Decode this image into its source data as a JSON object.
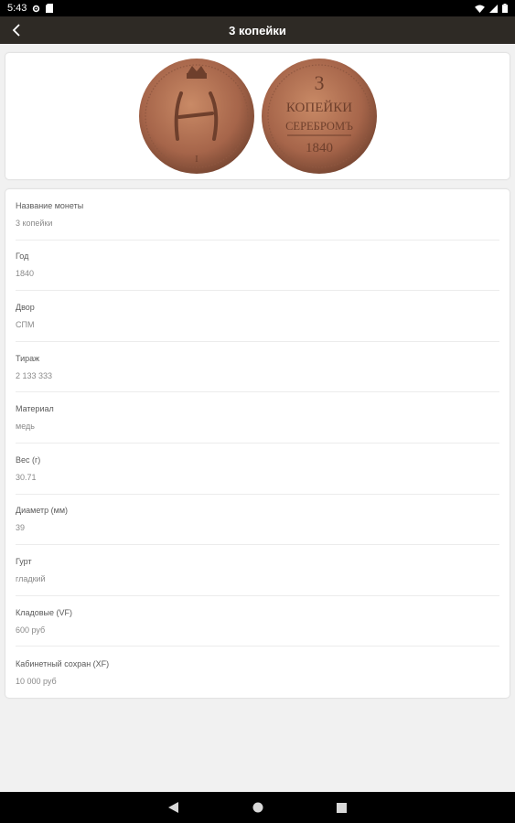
{
  "status_bar": {
    "time": "5:43"
  },
  "app_bar": {
    "title": "3 копейки"
  },
  "coin_images": {
    "reverse_text": [
      "3",
      "КОПЕЙКИ",
      "СЕРЕБРОМЪ",
      "1840"
    ],
    "obverse_letters": "Н"
  },
  "details": [
    {
      "label": "Название монеты",
      "value": "3 копейки"
    },
    {
      "label": "Год",
      "value": "1840"
    },
    {
      "label": "Двор",
      "value": "СПМ"
    },
    {
      "label": "Тираж",
      "value": "2 133 333"
    },
    {
      "label": "Материал",
      "value": "медь"
    },
    {
      "label": "Вес (г)",
      "value": "30.71"
    },
    {
      "label": "Диаметр (мм)",
      "value": "39"
    },
    {
      "label": "Гурт",
      "value": "гладкий"
    },
    {
      "label": "Кладовые (VF)",
      "value": "600 руб"
    },
    {
      "label": "Кабинетный сохран (XF)",
      "value": "10 000 руб"
    }
  ]
}
